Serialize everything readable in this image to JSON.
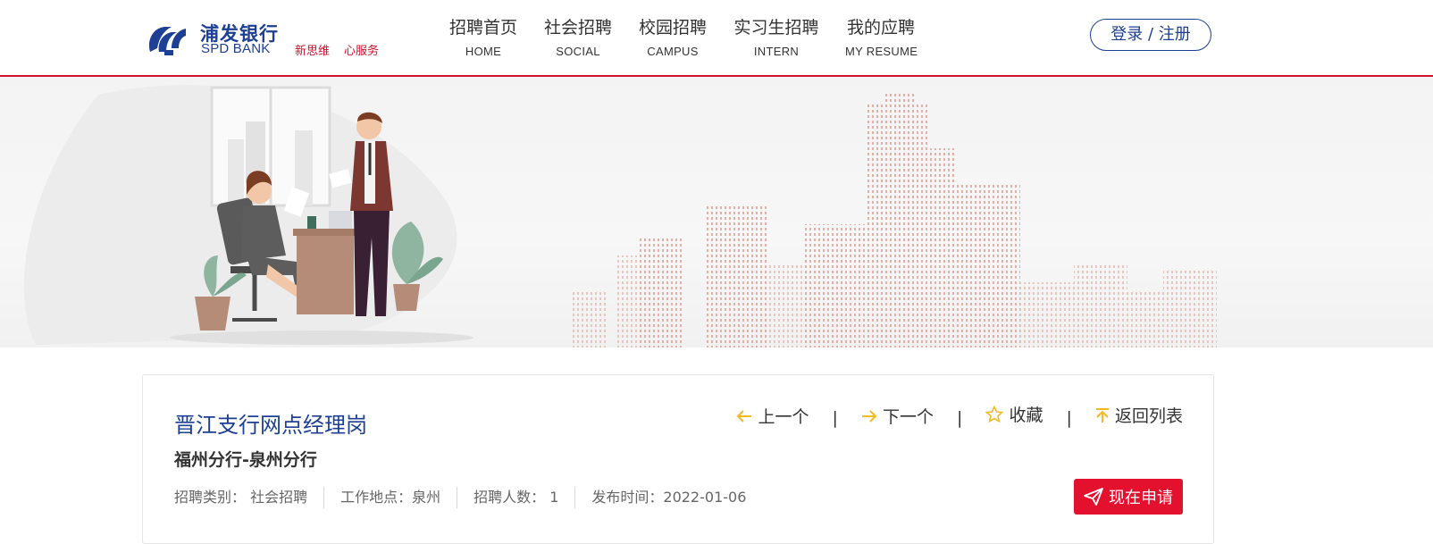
{
  "header": {
    "logo": {
      "cn": "浦发银行",
      "en": "SPD BANK",
      "slogan": [
        "新思维",
        "心服务"
      ]
    },
    "nav": [
      {
        "cn": "招聘首页",
        "en": "HOME"
      },
      {
        "cn": "社会招聘",
        "en": "SOCIAL"
      },
      {
        "cn": "校园招聘",
        "en": "CAMPUS"
      },
      {
        "cn": "实习生招聘",
        "en": "INTERN"
      },
      {
        "cn": "我的应聘",
        "en": "MY RESUME"
      }
    ],
    "login_label": "登录 / 注册"
  },
  "job": {
    "title": "晋江支行网点经理岗",
    "department": "福州分行-泉州分行",
    "meta": [
      "招聘类别：  社会招聘",
      "工作地点：泉州",
      "招聘人数：  1",
      "发布时间：2022-01-06"
    ],
    "actions": {
      "prev": "上一个",
      "next": "下一个",
      "favorite": "收藏",
      "back": "返回列表",
      "separator": "|"
    },
    "apply_label": "现在申请"
  },
  "colors": {
    "brand_blue": "#1d3f94",
    "brand_red": "#d0112b",
    "apply_red": "#e3112e",
    "icon_yellow": "#f5b921"
  }
}
